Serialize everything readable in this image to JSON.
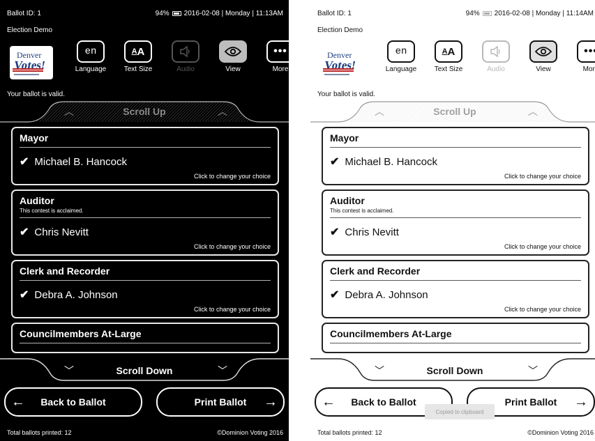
{
  "colors": {
    "dark_bg": "#000000",
    "light_bg": "#ffffff",
    "logo_blue": "#1d3f80",
    "logo_red": "#bb2222"
  },
  "logo": {
    "line1": "Denver",
    "line2": "Votes!"
  },
  "panels": [
    {
      "theme": "dark",
      "status": {
        "ballot_id": "Ballot ID: 1",
        "battery": "94%",
        "datetime": "2016-02-08 | Monday | 11:13AM"
      },
      "election": "Election Demo",
      "toolbar": [
        {
          "icon": "en",
          "label": "Language"
        },
        {
          "icon": "AA",
          "label": "Text Size"
        },
        {
          "icon": "speaker-icon",
          "label": "Audio"
        },
        {
          "icon": "eye-icon",
          "label": "View"
        },
        {
          "icon": "ellipsis-icon",
          "label": "More"
        }
      ],
      "valid_message": "Your ballot is valid.",
      "scroll_up": "Scroll Up",
      "scroll_down": "Scroll Down",
      "contests": [
        {
          "title": "Mayor",
          "note": "",
          "choice": "Michael B. Hancock",
          "hint": "Click to change your choice"
        },
        {
          "title": "Auditor",
          "note": "This contest is acclaimed.",
          "choice": "Chris Nevitt",
          "hint": "Click to change your choice"
        },
        {
          "title": "Clerk and Recorder",
          "note": "",
          "choice": "Debra A. Johnson",
          "hint": "Click to change your choice"
        },
        {
          "title": "Councilmembers At-Large",
          "note": "",
          "choice": "",
          "hint": ""
        }
      ],
      "back_button": "Back to Ballot",
      "print_button": "Print Ballot",
      "footer_left": "Total ballots printed: 12",
      "footer_right": "©Dominion Voting 2016"
    },
    {
      "theme": "light",
      "status": {
        "ballot_id": "Ballot ID: 1",
        "battery": "94%",
        "datetime": "2016-02-08 | Monday | 11:14AM"
      },
      "election": "Election Demo",
      "toolbar": [
        {
          "icon": "en",
          "label": "Language"
        },
        {
          "icon": "AA",
          "label": "Text Size"
        },
        {
          "icon": "speaker-icon",
          "label": "Audio"
        },
        {
          "icon": "eye-icon",
          "label": "View"
        },
        {
          "icon": "ellipsis-icon",
          "label": "More"
        }
      ],
      "valid_message": "Your ballot is valid.",
      "scroll_up": "Scroll Up",
      "scroll_down": "Scroll Down",
      "contests": [
        {
          "title": "Mayor",
          "note": "",
          "choice": "Michael B. Hancock",
          "hint": "Click to change your choice"
        },
        {
          "title": "Auditor",
          "note": "This contest is acclaimed.",
          "choice": "Chris Nevitt",
          "hint": "Click to change your choice"
        },
        {
          "title": "Clerk and Recorder",
          "note": "",
          "choice": "Debra A. Johnson",
          "hint": "Click to change your choice"
        },
        {
          "title": "Councilmembers At-Large",
          "note": "",
          "choice": "",
          "hint": ""
        }
      ],
      "back_button": "Back to Ballot",
      "print_button": "Print Ballot",
      "toast": "Copied to clipboard",
      "footer_left": "Total ballots printed: 12",
      "footer_right": "©Dominion Voting 2016"
    }
  ]
}
